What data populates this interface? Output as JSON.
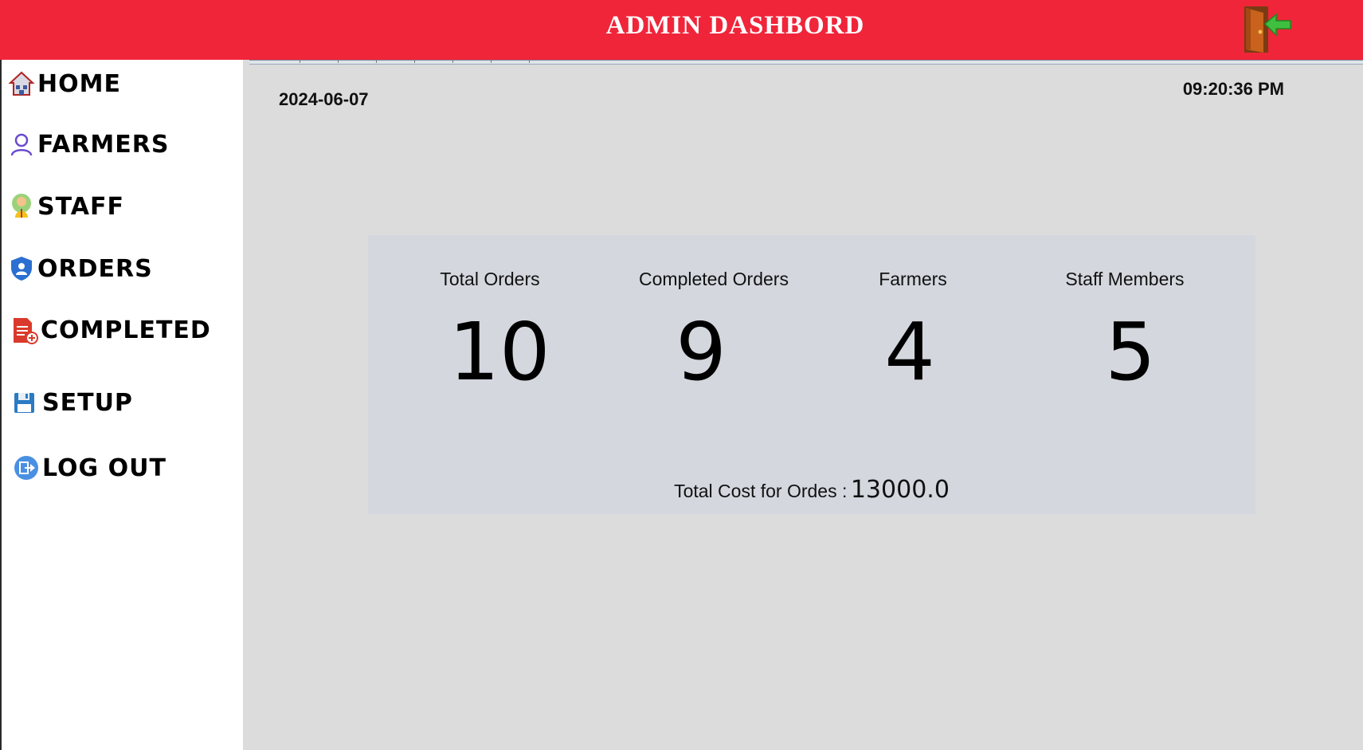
{
  "header": {
    "title": "ADMIN DASHBORD",
    "exit_icon": "exit-door-icon",
    "background_color": "#f0253a"
  },
  "sidebar": {
    "items": [
      {
        "label": "HOME",
        "icon": "home-icon"
      },
      {
        "label": "FARMERS",
        "icon": "user-icon"
      },
      {
        "label": "STAFF",
        "icon": "staff-icon"
      },
      {
        "label": "ORDERS",
        "icon": "shield-icon"
      },
      {
        "label": "COMPLETED",
        "icon": "document-add-icon"
      },
      {
        "label": "SETUP",
        "icon": "floppy-disk-icon"
      },
      {
        "label": "LOG OUT",
        "icon": "logout-icon"
      }
    ]
  },
  "main": {
    "date": "2024-06-07",
    "time": "09:20:36 PM",
    "stats": [
      {
        "label": "Total Orders",
        "value": "10"
      },
      {
        "label": "Completed Orders",
        "value": "9"
      },
      {
        "label": "Farmers",
        "value": "4"
      },
      {
        "label": "Staff Members",
        "value": "5"
      }
    ],
    "total_cost_label": "Total Cost for Ordes :",
    "total_cost_value": "13000.0"
  }
}
